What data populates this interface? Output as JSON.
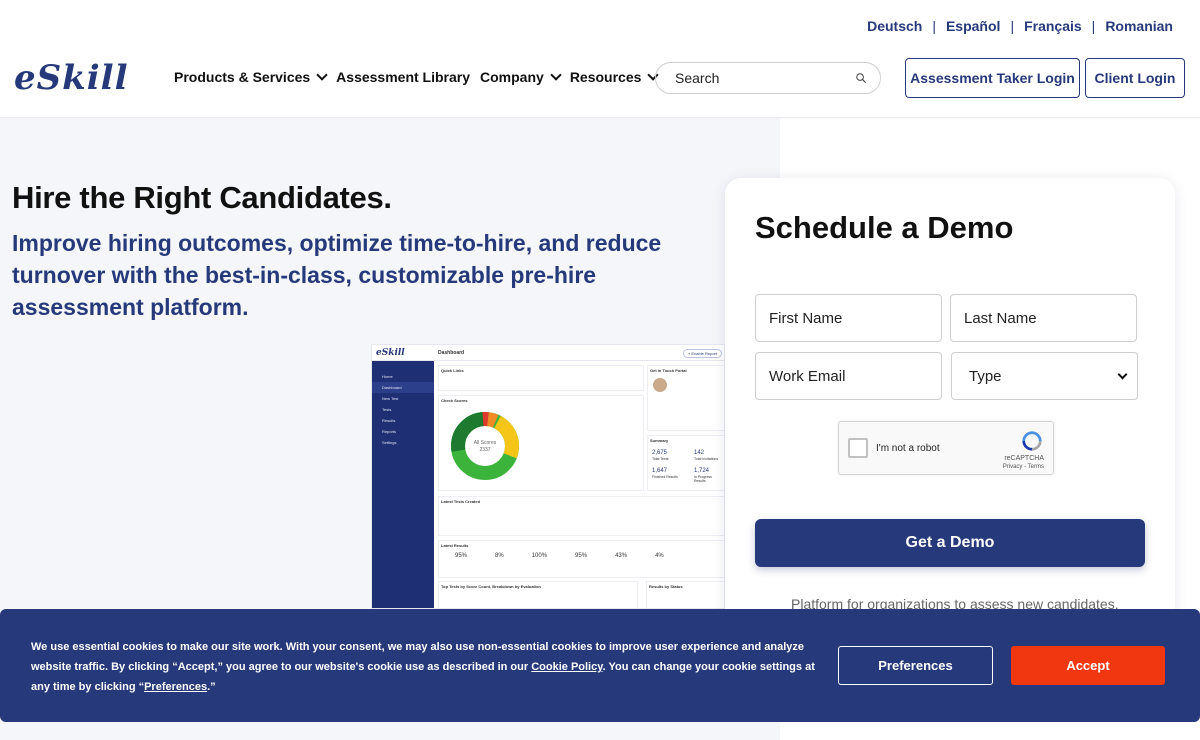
{
  "languages": [
    "Deutsch",
    "Español",
    "Français",
    "Romanian"
  ],
  "header": {
    "logo": "eSkill",
    "nav": [
      {
        "label": "Products & Services",
        "dropdown": true
      },
      {
        "label": "Assessment Library",
        "dropdown": false
      },
      {
        "label": "Company",
        "dropdown": true
      },
      {
        "label": "Resources",
        "dropdown": true
      }
    ],
    "search_placeholder": "Search",
    "taker_login": "Assessment Taker Login",
    "client_login": "Client Login"
  },
  "hero": {
    "title": "Hire the Right Candidates.",
    "subtitle": "Improve hiring outcomes, optimize time-to-hire, and reduce turnover with the best-in-class, customizable pre-hire assessment platform."
  },
  "dashboard": {
    "logo": "eSkill",
    "title": "Dashboard",
    "badge": "+ Enable Report",
    "sidebar": [
      "Home",
      "Dashboard",
      "New Test",
      "Tests",
      "Results",
      "Reports",
      "Settings"
    ],
    "quick_links_title": "Quick Links",
    "check_scores_title": "Check Scores",
    "donut_label": "All Scores",
    "donut_value": "2337",
    "summary_title": "Summary",
    "summary": [
      {
        "value": "2,675",
        "label": "Total Tests"
      },
      {
        "value": "142",
        "label": "Total Invitations"
      },
      {
        "value": "1,647",
        "label": "Finished Results"
      },
      {
        "value": "1,724",
        "label": "In Progress Results"
      }
    ],
    "latest_tests_title": "Latest Tests Created",
    "latest_results_title": "Latest Results",
    "latest_results": [
      "95%",
      "8%",
      "100%",
      "95%",
      "43%",
      "4%"
    ],
    "top_tests_title": "Top Tests by Score Count, Breakdown by Evaluation",
    "results_status_title": "Results by Status",
    "contact_title": "Get in Touch Portal"
  },
  "form": {
    "title": "Schedule a Demo",
    "first_name": "First Name",
    "last_name": "Last Name",
    "work_email": "Work Email",
    "type": "Type",
    "captcha_label": "I'm not a robot",
    "captcha_brand": "reCAPTCHA",
    "captcha_terms": "Privacy - Terms",
    "submit": "Get a Demo",
    "note": "Platform for organizations to assess new candidates."
  },
  "cookie": {
    "text_1": "We use essential cookies to make our site work. With your consent, we may also use non-essential cookies to improve user experience and analyze website traffic. By clicking “Accept,” you agree to our website's cookie use as described in our ",
    "policy_link": "Cookie Policy",
    "text_2": ". You can change your cookie settings at any time by clicking “",
    "prefs_link": "Preferences",
    "text_3": ".”",
    "preferences_button": "Preferences",
    "accept_button": "Accept"
  },
  "colors": {
    "brand": "#26397a",
    "accept": "#f0370f",
    "donut_green": "#3cb43c",
    "donut_dark_green": "#1e7a2e",
    "donut_yellow": "#f5c518",
    "donut_orange": "#f08a24",
    "donut_red": "#e03a2e"
  }
}
